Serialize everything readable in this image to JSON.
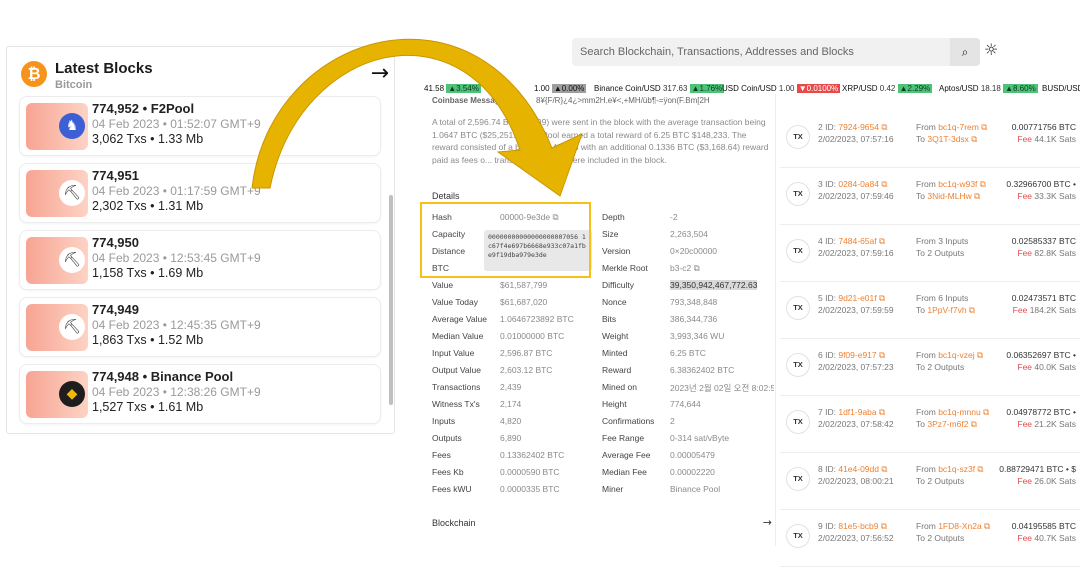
{
  "latest_blocks": {
    "title": "Latest Blocks",
    "subtitle": "Bitcoin",
    "logo_glyph": "₿",
    "arrow_glyph": "→",
    "blocks": [
      {
        "line1": "774,952 • F2Pool",
        "line2": "04 Feb 2023 • 01:52:07 GMT+9",
        "line3": "3,062 Txs • 1.33 Mb",
        "badge": "f2pool-icon"
      },
      {
        "line1": "774,951",
        "line2": "04 Feb 2023 • 01:17:59 GMT+9",
        "line3": "2,302 Txs • 1.31 Mb",
        "badge": "pickaxe-icon"
      },
      {
        "line1": "774,950",
        "line2": "04 Feb 2023 • 12:53:45 GMT+9",
        "line3": "1,158 Txs • 1.69 Mb",
        "badge": "pickaxe-icon"
      },
      {
        "line1": "774,949",
        "line2": "04 Feb 2023 • 12:45:35 GMT+9",
        "line3": "1,863 Txs • 1.52 Mb",
        "badge": "pickaxe-icon"
      },
      {
        "line1": "774,948 • Binance Pool",
        "line2": "04 Feb 2023 • 12:38:26 GMT+9",
        "line3": "1,527 Txs • 1.61 Mb",
        "badge": "binance-icon"
      }
    ]
  },
  "explorer": {
    "search_placeholder": "Search Blockchain, Transactions, Addresses and Blocks",
    "search_glyph": "⌕",
    "theme_glyph": "☼",
    "ticker": [
      {
        "label": "",
        "price": "41.58",
        "change": "▲3.54%",
        "dir": "up"
      },
      {
        "label": "",
        "price": "1.00",
        "change": "▲0.00%",
        "dir": "flat"
      },
      {
        "label": "Binance Coin/USD",
        "price": "317.63",
        "change": "▲1.76%",
        "dir": "up"
      },
      {
        "label": "USD Coin/USD",
        "price": "1.00",
        "change": "▼0.0100%",
        "dir": "down"
      },
      {
        "label": "XRP/USD",
        "price": "0.42",
        "change": "▲2.29%",
        "dir": "up"
      },
      {
        "label": "Aptos/USD",
        "price": "18.18",
        "change": "▲8.60%",
        "dir": "up"
      },
      {
        "label": "BUSD/USD",
        "price": "",
        "change": "",
        "dir": "none"
      }
    ],
    "coinbase_title": "Coinbase Message",
    "coinbase_code": "8¥{F/R}¿4¿>mm2H.e¥<,+MH/üb¶-=ÿon(F.Bm[2H",
    "coinbase_text": "A total of 2,596.74 BTC ($...99) were sent in the block with the average transaction being 1.0647 BTC ($25,251.9...). ...Pool earned a total reward of 6.25 BTC $148,233. The reward consisted of a base... $148,233 with an additional 0.1336 BTC ($3,168.64) reward paid as fees o... transactions which were included in the block.",
    "details_heading": "Details",
    "hash_popup": "00000000000000000007056 1c67f4e697b6668e933c07a1fbe9f19dba979e3de",
    "left_rows": [
      {
        "k": "Hash",
        "v": "00000-9e3de ⧉"
      },
      {
        "k": "Capacity",
        "v": ""
      },
      {
        "k": "Distance",
        "v": ""
      },
      {
        "k": "BTC",
        "v": ""
      },
      {
        "k": "Value",
        "v": "$61,587,799"
      },
      {
        "k": "Value Today",
        "v": "$61,687,020"
      },
      {
        "k": "Average Value",
        "v": "1.0646723892 BTC"
      },
      {
        "k": "Median Value",
        "v": "0.01000000 BTC"
      },
      {
        "k": "Input Value",
        "v": "2,596.87 BTC"
      },
      {
        "k": "Output Value",
        "v": "2,603.12 BTC"
      },
      {
        "k": "Transactions",
        "v": "2,439"
      },
      {
        "k": "Witness Tx's",
        "v": "2,174"
      },
      {
        "k": "Inputs",
        "v": "4,820"
      },
      {
        "k": "Outputs",
        "v": "6,890"
      },
      {
        "k": "Fees",
        "v": "0.13362402 BTC"
      },
      {
        "k": "Fees Kb",
        "v": "0.0000590 BTC"
      },
      {
        "k": "Fees kWU",
        "v": "0.0000335 BTC"
      }
    ],
    "right_rows": [
      {
        "k": "Depth",
        "v": "-2"
      },
      {
        "k": "Size",
        "v": "2,263,504"
      },
      {
        "k": "Version",
        "v": "0×20c00000"
      },
      {
        "k": "Merkle Root",
        "v": "b3-c2 ⧉"
      },
      {
        "k": "Difficulty",
        "v": "39,350,942,467,772.63"
      },
      {
        "k": "Nonce",
        "v": "793,348,848"
      },
      {
        "k": "Bits",
        "v": "386,344,736"
      },
      {
        "k": "Weight",
        "v": "3,993,346 WU"
      },
      {
        "k": "Minted",
        "v": "6.25 BTC"
      },
      {
        "k": "Reward",
        "v": "6.38362402 BTC"
      },
      {
        "k": "Mined on",
        "v": "2023년 2월 02일 오전 8:02:5("
      },
      {
        "k": "Height",
        "v": "774,644"
      },
      {
        "k": "Confirmations",
        "v": "2"
      },
      {
        "k": "Fee Range",
        "v": "0-314 sat/vByte"
      },
      {
        "k": "Average Fee",
        "v": "0.00005479"
      },
      {
        "k": "Median Fee",
        "v": "0.00002220"
      },
      {
        "k": "Miner",
        "v": "Binance Pool"
      }
    ],
    "blockchain_label": "Blockchain",
    "blockchain_arrow": "→",
    "transactions": [
      {
        "num": "2",
        "id": "7924-9654 ⧉",
        "time": "2/02/2023, 07:57:16",
        "from_prefix": "From ",
        "from": "bc1q-7rem ⧉",
        "to_prefix": "To ",
        "to": "3Q1T-3dsx ⧉",
        "amount": "0.00771756 BTC",
        "fee": "44.1K Sats"
      },
      {
        "num": "3",
        "id": "0284-0a84 ⧉",
        "time": "2/02/2023, 07:59:46",
        "from_prefix": "From ",
        "from": "bc1q-w93f ⧉",
        "to_prefix": "To ",
        "to": "3Nid-MLHw ⧉",
        "amount": "0.32966700 BTC •",
        "fee": "33.3K Sats"
      },
      {
        "num": "4",
        "id": "7484-65af ⧉",
        "time": "2/02/2023, 07:59:16",
        "from_prefix": "From 3 Inputs",
        "from": "",
        "to_prefix": "To 2 Outputs",
        "to": "",
        "amount": "0.02585337 BTC",
        "fee": "82.8K Sats"
      },
      {
        "num": "5",
        "id": "9d21-e01f ⧉",
        "time": "2/02/2023, 07:59:59",
        "from_prefix": "From 6 Inputs",
        "from": "",
        "to_prefix": "To ",
        "to": "1PpV-f7vh ⧉",
        "amount": "0.02473571 BTC",
        "fee": "184.2K Sats"
      },
      {
        "num": "6",
        "id": "9f09-e917 ⧉",
        "time": "2/02/2023, 07:57:23",
        "from_prefix": "From ",
        "from": "bc1q-vzej ⧉",
        "to_prefix": "To 2 Outputs",
        "to": "",
        "amount": "0.06352697 BTC •",
        "fee": "40.0K Sats"
      },
      {
        "num": "7",
        "id": "1df1-9aba ⧉",
        "time": "2/02/2023, 07:58:42",
        "from_prefix": "From ",
        "from": "bc1q-mnnu ⧉",
        "to_prefix": "To ",
        "to": "3Pz7-m6f2 ⧉",
        "amount": "0.04978772 BTC •",
        "fee": "21.2K Sats"
      },
      {
        "num": "8",
        "id": "41e4-09dd ⧉",
        "time": "2/02/2023, 08:00:21",
        "from_prefix": "From ",
        "from": "bc1q-sz3f ⧉",
        "to_prefix": "To 2 Outputs",
        "to": "",
        "amount": "0.88729471 BTC • $",
        "fee": "26.0K Sats"
      },
      {
        "num": "9",
        "id": "81e5-bcb9 ⧉",
        "time": "2/02/2023, 07:56:52",
        "from_prefix": "From ",
        "from": "1FD8-Xn2a ⧉",
        "to_prefix": "To 2 Outputs",
        "to": "",
        "amount": "0.04195585 BTC",
        "fee": "40.7K Sats"
      }
    ],
    "tx_label": "TX",
    "id_label": "ID: ",
    "fee_label": "Fee "
  },
  "colors": {
    "bitcoin_orange": "#f7931a",
    "highlight_yellow": "#f5c017",
    "link_orange": "#f0802f",
    "fee_red": "#e24c4c"
  }
}
